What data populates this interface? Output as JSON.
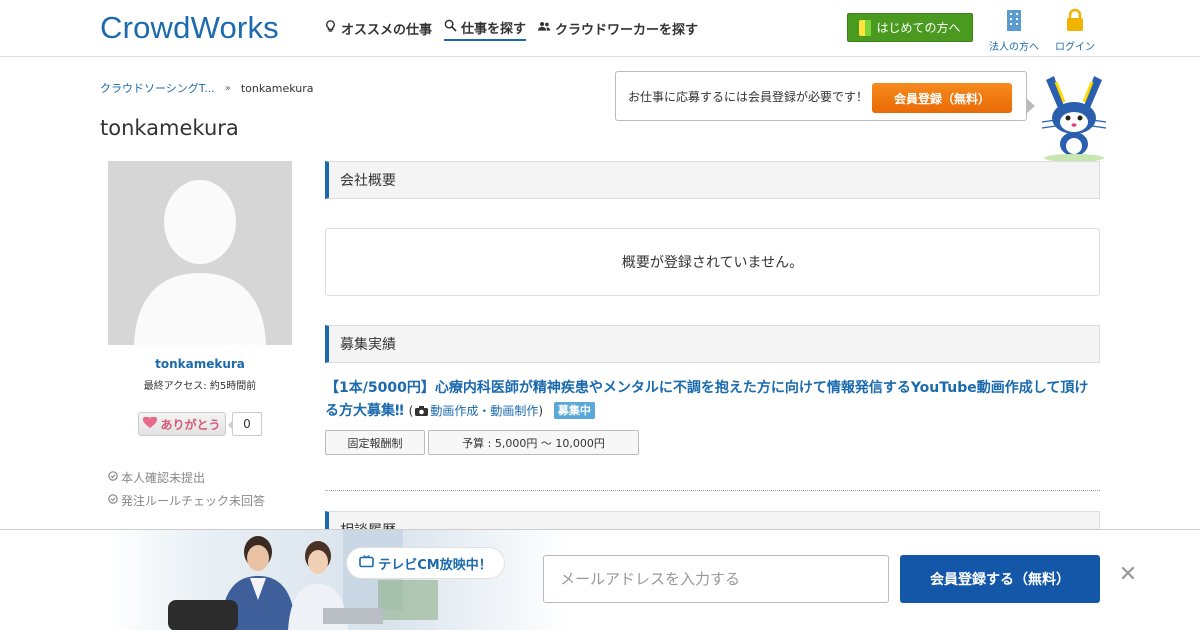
{
  "header": {
    "logo": "CrowdWorks",
    "nav": [
      {
        "label": "オススメの仕事",
        "icon": "lightbulb-icon"
      },
      {
        "label": "仕事を探す",
        "icon": "search-icon",
        "active": true
      },
      {
        "label": "クラウドワーカーを探す",
        "icon": "users-icon"
      }
    ],
    "beginner_button": "はじめての方へ",
    "corporate_label": "法人の方へ",
    "login_label": "ログイン"
  },
  "breadcrumb": {
    "parent": "クラウドソーシングT...",
    "current": "tonkamekura"
  },
  "page_title": "tonkamekura",
  "register_prompt": {
    "text": "お仕事に応募するには会員登録が必要です！",
    "button": "会員登録（無料）"
  },
  "profile": {
    "name": "tonkamekura",
    "last_access": "最終アクセス: 約5時間前",
    "thanks_label": "ありがとう",
    "thanks_count": "0",
    "statuses": [
      "本人確認未提出",
      "発注ルールチェック未回答"
    ]
  },
  "sections": {
    "company_overview": "会社概要",
    "no_overview": "概要が登録されていません。",
    "recruit_history": "募集実績",
    "next_section": "相談履歴"
  },
  "job": {
    "title": "【1本/5000円】心療内科医師が精神疾患やメンタルに不調を抱えた方に向けて情報発信するYouTube動画作成して頂ける方大募集‼",
    "category": "動画作成・動画制作",
    "status": "募集中",
    "type": "固定報酬制",
    "budget": "予算 : 5,000円 〜 10,000円"
  },
  "banner": {
    "tv_text": "テレビCM放映中！",
    "email_placeholder": "メールアドレスを入力する",
    "signup_button": "会員登録する（無料）",
    "close": "✕"
  },
  "colors": {
    "brand_blue": "#1a6aad",
    "orange": "#f07a12",
    "green": "#4a9a20",
    "signup_blue": "#1456a8"
  }
}
